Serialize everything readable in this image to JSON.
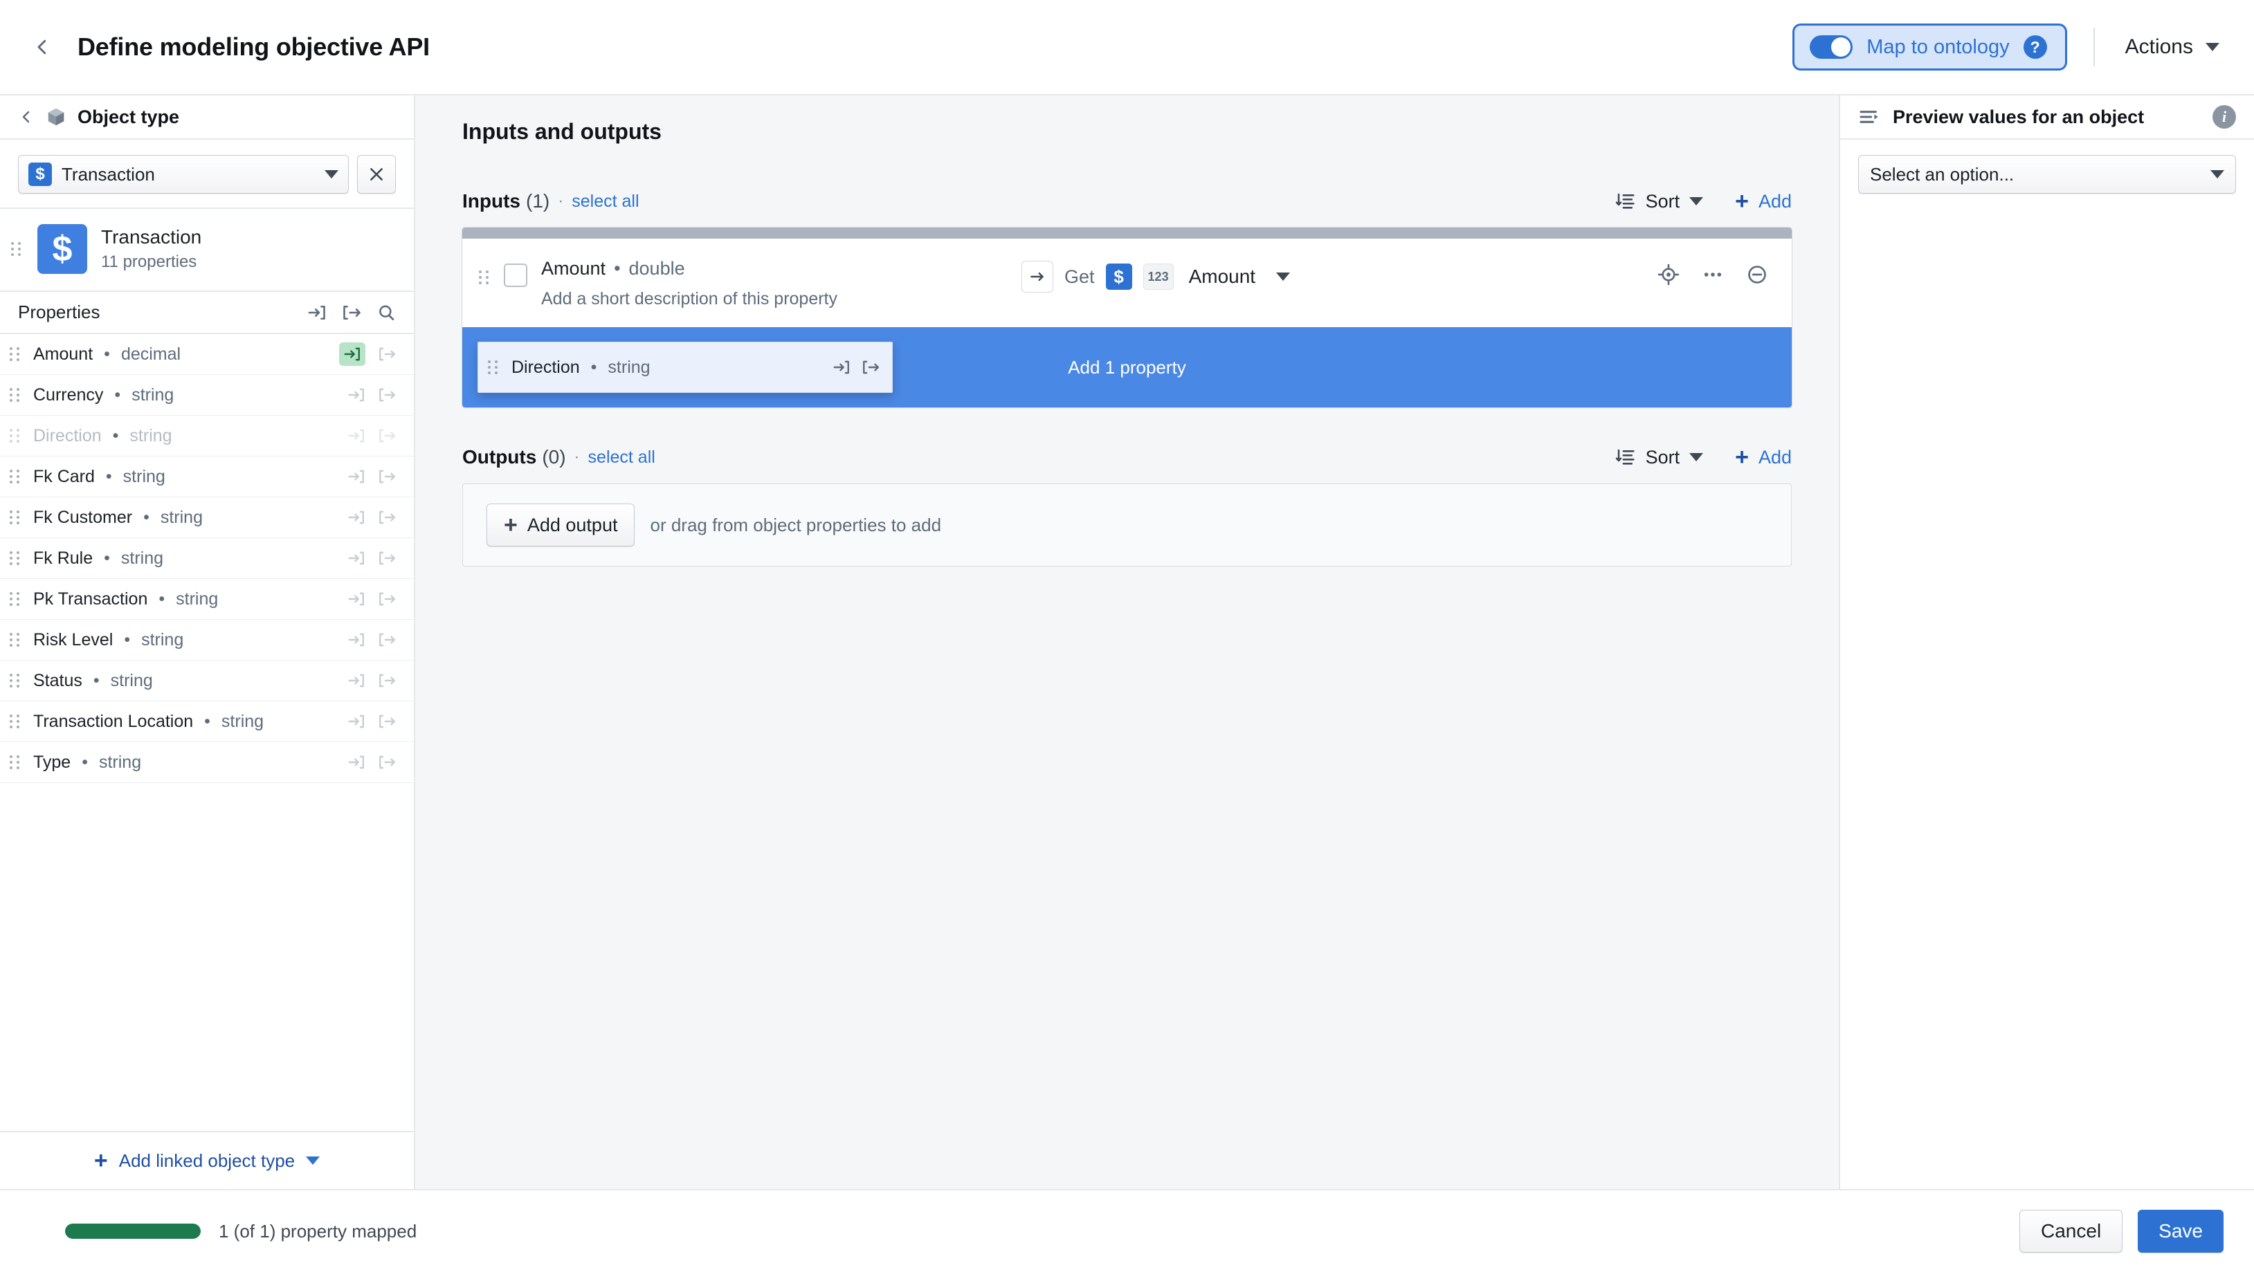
{
  "topbar": {
    "back_icon": "chevron-left-icon",
    "title": "Define modeling objective API",
    "map_toggle_label": "Map to ontology",
    "map_toggle_on": true,
    "help_label": "?",
    "actions_label": "Actions"
  },
  "sidebar": {
    "header_title": "Object type",
    "header_icon": "cube-icon",
    "selector": {
      "badge": "$",
      "value": "Transaction",
      "clear_icon": "close-icon"
    },
    "object_card": {
      "badge": "$",
      "name": "Transaction",
      "subtitle": "11 properties"
    },
    "properties_header": {
      "title": "Properties",
      "icons": [
        "input-arrow-icon",
        "output-arrow-icon",
        "search-icon"
      ]
    },
    "properties": [
      {
        "name": "Amount",
        "type": "decimal",
        "dim": false,
        "input_mapped": true
      },
      {
        "name": "Currency",
        "type": "string",
        "dim": false,
        "input_mapped": false
      },
      {
        "name": "Direction",
        "type": "string",
        "dim": true,
        "input_mapped": false
      },
      {
        "name": "Fk Card",
        "type": "string",
        "dim": false,
        "input_mapped": false
      },
      {
        "name": "Fk Customer",
        "type": "string",
        "dim": false,
        "input_mapped": false
      },
      {
        "name": "Fk Rule",
        "type": "string",
        "dim": false,
        "input_mapped": false
      },
      {
        "name": "Pk Transaction",
        "type": "string",
        "dim": false,
        "input_mapped": false
      },
      {
        "name": "Risk Level",
        "type": "string",
        "dim": false,
        "input_mapped": false
      },
      {
        "name": "Status",
        "type": "string",
        "dim": false,
        "input_mapped": false
      },
      {
        "name": "Transaction Location",
        "type": "string",
        "dim": false,
        "input_mapped": false
      },
      {
        "name": "Type",
        "type": "string",
        "dim": false,
        "input_mapped": false
      }
    ],
    "footer_label": "Add linked object type"
  },
  "center": {
    "title": "Inputs and outputs",
    "inputs": {
      "label": "Inputs",
      "count": "(1)",
      "separator": "·",
      "select_all": "select all",
      "sort_label": "Sort",
      "add_label": "Add",
      "rows": [
        {
          "name": "Amount",
          "type": "double",
          "separator": "•",
          "description_placeholder": "Add a short description of this property",
          "mapping": {
            "verb": "Get",
            "object_badge": "$",
            "type_badge": "123",
            "value": "Amount"
          },
          "right_icons": [
            "target-icon",
            "more-icon",
            "remove-icon"
          ]
        }
      ],
      "drop_zone": {
        "chip_name": "Direction",
        "chip_type": "string",
        "chip_separator": "•",
        "hint": "Add 1 property"
      }
    },
    "outputs": {
      "label": "Outputs",
      "count": "(0)",
      "separator": "·",
      "select_all": "select all",
      "sort_label": "Sort",
      "add_label": "Add",
      "add_output_label": "Add output",
      "drag_hint": "or drag from object properties to add"
    }
  },
  "rightpanel": {
    "title": "Preview values for an object",
    "header_icon": "list-arrow-icon",
    "info_icon": "info-icon",
    "select_placeholder": "Select an option..."
  },
  "bottombar": {
    "progress_label": "1 (of 1) property mapped",
    "progress_percent": 100,
    "cancel_label": "Cancel",
    "save_label": "Save"
  },
  "colors": {
    "accent_blue": "#2d72d2",
    "drop_zone_blue": "#4a88e5",
    "progress_green": "#1d7a4c",
    "panel_bg": "#f5f6f8",
    "badge_blue": "#3f7fe0"
  }
}
